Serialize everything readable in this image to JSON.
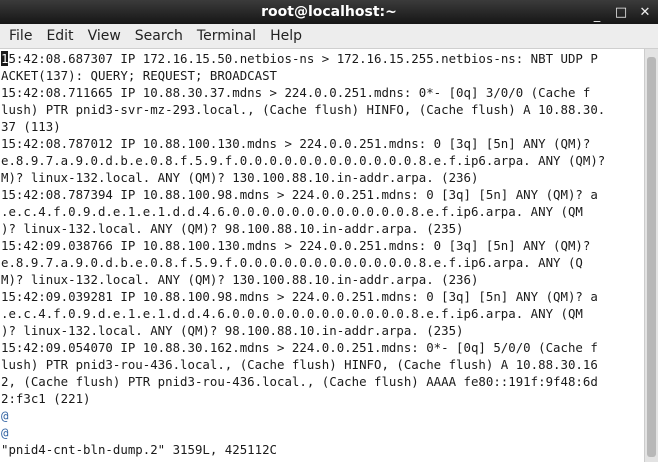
{
  "window": {
    "title": "root@localhost:~",
    "controls": {
      "minimize": "_",
      "maximize": "□",
      "close": "✕"
    }
  },
  "menu": [
    "File",
    "Edit",
    "View",
    "Search",
    "Terminal",
    "Help"
  ],
  "terminal": {
    "cursor_char": "1",
    "first_line_rest": "5:42:08.687307 IP 172.16.15.50.netbios-ns > 172.16.15.255.netbios-ns: NBT UDP P",
    "lines": [
      "ACKET(137): QUERY; REQUEST; BROADCAST",
      "15:42:08.711665 IP 10.88.30.37.mdns > 224.0.0.251.mdns: 0*- [0q] 3/0/0 (Cache f",
      "lush) PTR pnid3-svr-mz-293.local., (Cache flush) HINFO, (Cache flush) A 10.88.30.",
      "37 (113)",
      "15:42:08.787012 IP 10.88.100.130.mdns > 224.0.0.251.mdns: 0 [3q] [5n] ANY (QM)?",
      "e.8.9.7.a.9.0.d.b.e.0.8.f.5.9.f.0.0.0.0.0.0.0.0.0.0.0.0.8.e.f.ip6.arpa. ANY (QM)?",
      "M)? linux-132.local. ANY (QM)? 130.100.88.10.in-addr.arpa. (236)",
      "15:42:08.787394 IP 10.88.100.98.mdns > 224.0.0.251.mdns: 0 [3q] [5n] ANY (QM)? a",
      ".e.c.4.f.0.9.d.e.1.e.1.d.d.4.6.0.0.0.0.0.0.0.0.0.0.0.0.8.e.f.ip6.arpa. ANY (QM",
      ")? linux-132.local. ANY (QM)? 98.100.88.10.in-addr.arpa. (235)",
      "15:42:09.038766 IP 10.88.100.130.mdns > 224.0.0.251.mdns: 0 [3q] [5n] ANY (QM)?",
      "e.8.9.7.a.9.0.d.b.e.0.8.f.5.9.f.0.0.0.0.0.0.0.0.0.0.0.0.8.e.f.ip6.arpa. ANY (Q",
      "M)? linux-132.local. ANY (QM)? 130.100.88.10.in-addr.arpa. (236)",
      "15:42:09.039281 IP 10.88.100.98.mdns > 224.0.0.251.mdns: 0 [3q] [5n] ANY (QM)? a",
      ".e.c.4.f.0.9.d.e.1.e.1.d.d.4.6.0.0.0.0.0.0.0.0.0.0.0.0.8.e.f.ip6.arpa. ANY (QM",
      ")? linux-132.local. ANY (QM)? 98.100.88.10.in-addr.arpa. (235)",
      "15:42:09.054070 IP 10.88.30.162.mdns > 224.0.0.251.mdns: 0*- [0q] 5/0/0 (Cache f",
      "lush) PTR pnid3-rou-436.local., (Cache flush) HINFO, (Cache flush) A 10.88.30.16",
      "2, (Cache flush) PTR pnid3-rou-436.local., (Cache flush) AAAA fe80::191f:9f48:6d",
      "2:f3c1 (221)"
    ],
    "filler_lines": [
      "@",
      "@"
    ],
    "status_line": "\"pnid4-cnt-bln-dump.2\" 3159L, 425112C",
    "text_color": "#1a1a1a",
    "filler_color": "#3465a4"
  }
}
